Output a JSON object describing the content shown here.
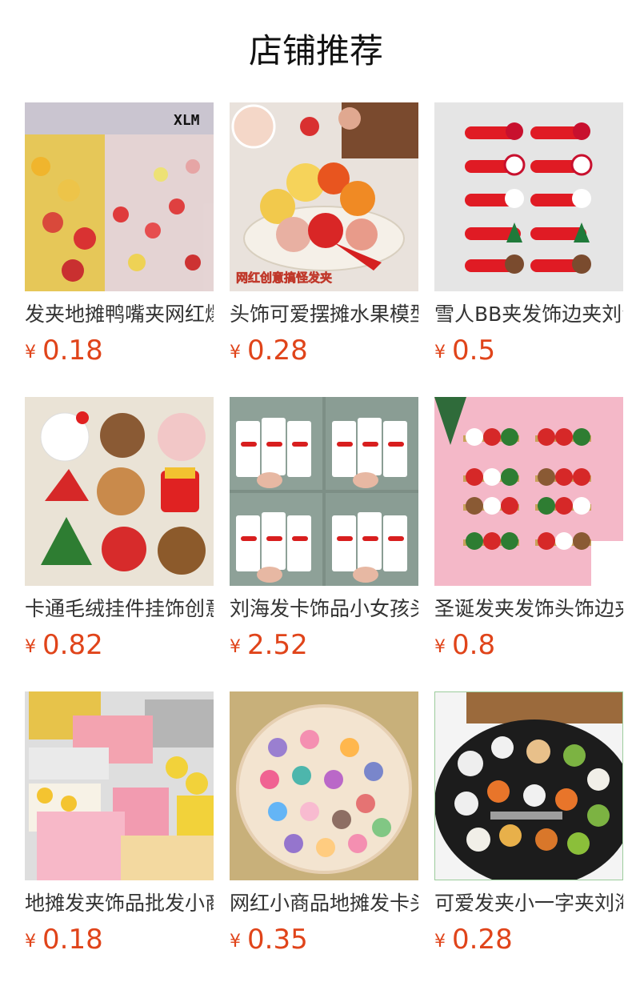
{
  "section_title": "店铺推荐",
  "currency": "¥",
  "products": [
    {
      "name": "发夹地摊鸭嘴夹网红爆款",
      "price": "0.18",
      "overlay": "XLM"
    },
    {
      "name": "头饰可爱摆摊水果模型发夹",
      "price": "0.28",
      "overlay": "网红创意搞怪发夹"
    },
    {
      "name": "雪人BB夹发饰边夹刘海夹",
      "price": "0.5"
    },
    {
      "name": "卡通毛绒挂件挂饰创意",
      "price": "0.82"
    },
    {
      "name": "刘海发卡饰品小女孩头饰",
      "price": "2.52"
    },
    {
      "name": "圣诞发夹发饰头饰边夹",
      "price": "0.8"
    },
    {
      "name": "地摊发夹饰品批发小商品",
      "price": "0.18"
    },
    {
      "name": "网红小商品地摊发卡头饰",
      "price": "0.35"
    },
    {
      "name": "可爱发夹小一字夹刘海夹",
      "price": "0.28"
    }
  ],
  "colors": {
    "price": "#e0441a",
    "text": "#333333"
  }
}
